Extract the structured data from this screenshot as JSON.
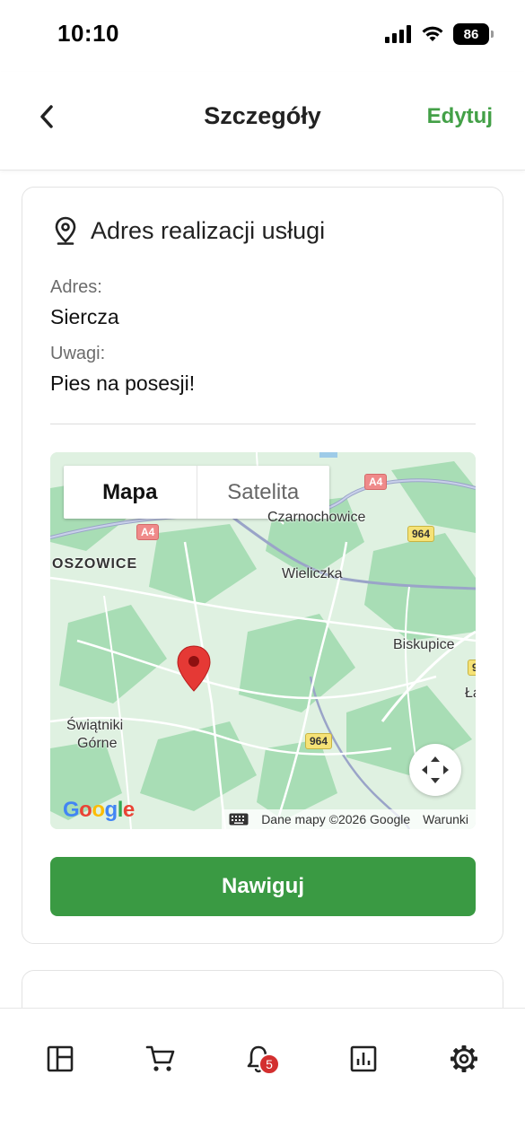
{
  "status_bar": {
    "time": "10:10",
    "battery": "86"
  },
  "header": {
    "title": "Szczegóły",
    "edit_label": "Edytuj",
    "back_icon": "chevron-left-icon"
  },
  "address_card": {
    "title": "Adres realizacji usługi",
    "icon": "location-pin-icon",
    "address_label": "Adres:",
    "address_value": "Siercza",
    "notes_label": "Uwagi:",
    "notes_value": "Pies na posesji!"
  },
  "map": {
    "tabs": [
      {
        "label": "Mapa",
        "active": true
      },
      {
        "label": "Satelita",
        "active": false
      }
    ],
    "places": [
      "Czarnochowice",
      "OSZOWICE",
      "Wieliczka",
      "Biskupice",
      "Świątniki",
      "Górne",
      "Łą"
    ],
    "road_badges": [
      "A4",
      "A4",
      "964",
      "964",
      "9"
    ],
    "logo": "Google",
    "attribution": "Dane mapy ©2026 Google",
    "terms": "Warunki",
    "colors": {
      "land": "#d9f0dc",
      "forest": "#a8ddb5",
      "road": "#ffffff",
      "marker": "#e53935"
    }
  },
  "navigate_button": {
    "label": "Nawiguj",
    "color": "#3a9a43"
  },
  "bottom_nav": {
    "items": [
      {
        "icon": "dashboard-icon"
      },
      {
        "icon": "cart-icon"
      },
      {
        "icon": "bell-icon",
        "badge": "5"
      },
      {
        "icon": "chart-icon"
      },
      {
        "icon": "gear-icon"
      }
    ]
  },
  "accent_color": "#43a047"
}
